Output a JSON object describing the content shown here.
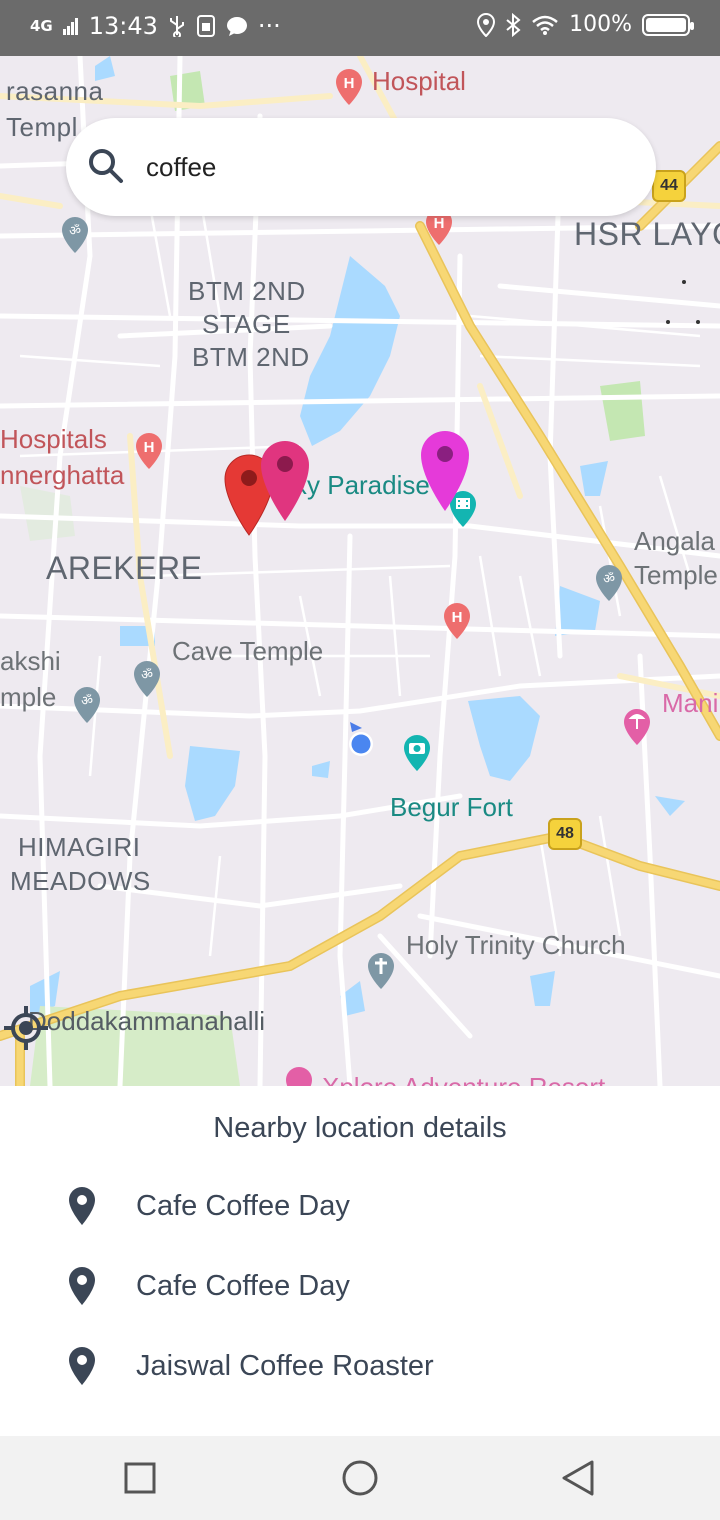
{
  "status_bar": {
    "network": "4G",
    "time": "13:43",
    "battery": "100%",
    "more": "···"
  },
  "search": {
    "value": "coffee"
  },
  "map": {
    "area_labels": {
      "prasanna": "rasanna",
      "temple_top": "Templ",
      "btm_line1": "BTM 2ND",
      "btm_line2": "STAGE",
      "btm_line3": "BTM 2ND",
      "hsr": "HSR LAYO",
      "arekere": "AREKERE",
      "angala": "Angala",
      "angala_temple": "Temple",
      "akshi": "akshi",
      "akshi_temple": "mple",
      "himagiri1": "HIMAGIRI",
      "himagiri2": "MEADOWS",
      "dodda": "Doddakammanahalli"
    },
    "poi_labels": {
      "hospital": "Hospital",
      "hospitals": "Hospitals",
      "bannerghatta": "nnerghatta",
      "paradise": "xy Paradise",
      "cave_temple": "Cave Temple",
      "begur_fort": "Begur Fort",
      "holy_trinity": "Holy Trinity Church",
      "mani": "Mani",
      "xplore": "Xplore Adventure Resort"
    },
    "highway_44": "44",
    "highway_48": "48",
    "pins": [
      {
        "color": "#e53935",
        "inner": "#8e1b1b"
      },
      {
        "color": "#e0357f",
        "inner": "#8c1a4d"
      },
      {
        "color": "#e53ad9",
        "inner": "#8a1f80"
      }
    ]
  },
  "nearby": {
    "title": "Nearby location details",
    "items": [
      {
        "name": "Cafe Coffee Day"
      },
      {
        "name": "Cafe Coffee Day"
      },
      {
        "name": "Jaiswal Coffee Roaster"
      }
    ]
  },
  "colors": {
    "text_dark": "#3b4656",
    "map_bg": "#eeeaf0",
    "road_yellow": "#f7d774",
    "water": "#aadaff",
    "park": "#c4e7b2"
  }
}
